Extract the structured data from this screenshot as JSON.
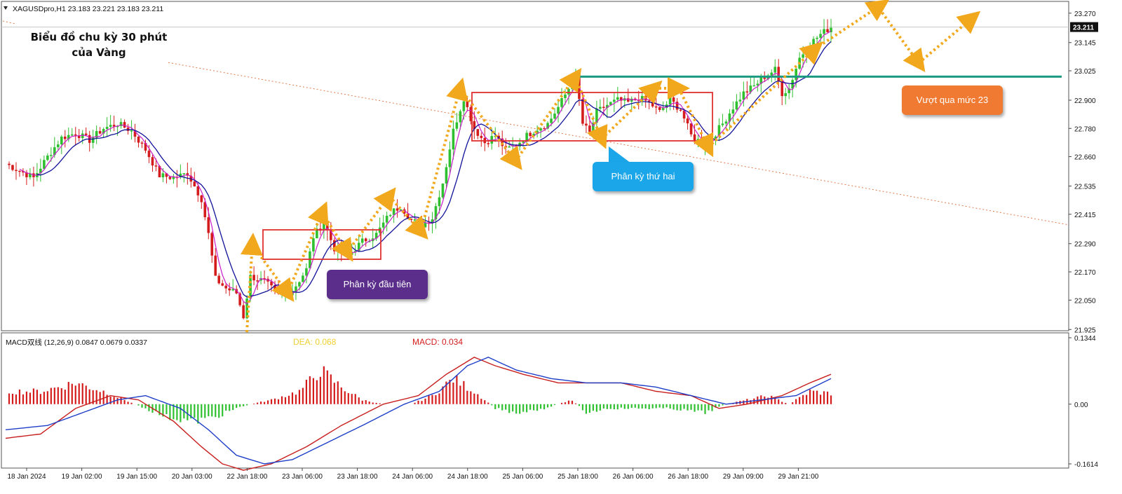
{
  "symbol_header": "XAGUSDpro,H1  23.183 23.221 23.183 23.211",
  "heading": {
    "line1": "Biểu đồ chu kỳ 30 phút",
    "line2": "của Vàng"
  },
  "callouts": {
    "first_divergence": "Phân kỳ đầu tiên",
    "second_divergence": "Phân kỳ thứ hai",
    "breakout": "Vượt qua mức 23"
  },
  "colors": {
    "bull": "#2fc02f",
    "bear": "#d41c1c",
    "ma_fast": "#c81ec8",
    "ma_slow": "#12129a",
    "resistance": "#1a9a80",
    "arrows": "#f2a81c",
    "box": "#e03030",
    "trendline": "#e07a4a",
    "first_callout": "#5b2e8c",
    "second_callout": "#1aa6e8",
    "breakout_callout": "#f07a32",
    "dea_label": "#f0d030",
    "macd_label": "#d41c1c"
  },
  "macd_panel": {
    "header": "MACD双线 (12,26,9) 0.0847 0.0679 0.0337",
    "dea_label": "DEA:  0.068",
    "macd_label": "MACD:  0.034"
  },
  "chart_data": {
    "type": "candlestick",
    "price_axis": {
      "ticks": [
        "23.270",
        "23.145",
        "23.025",
        "22.900",
        "22.780",
        "22.660",
        "22.535",
        "22.415",
        "22.290",
        "22.170",
        "22.050",
        "21.925"
      ],
      "current": "23.211",
      "range": [
        21.89,
        23.32
      ]
    },
    "macd_axis": {
      "ticks": [
        "0.1344",
        "0.00",
        "-0.1614"
      ],
      "range": [
        -0.1614,
        0.1344
      ]
    },
    "x_ticks": [
      "18 Jan 2024",
      "19 Jan 02:00",
      "19 Jan 15:00",
      "20 Jan 03:00",
      "22 Jan 18:00",
      "23 Jan 06:00",
      "23 Jan 18:00",
      "24 Jan 06:00",
      "24 Jan 18:00",
      "25 Jan 06:00",
      "25 Jan 18:00",
      "26 Jan 06:00",
      "26 Jan 18:00",
      "29 Jan 09:00",
      "29 Jan 21:00"
    ],
    "resistance_level": 23.0,
    "close_anchors": [
      [
        0,
        22.63
      ],
      [
        4,
        22.6
      ],
      [
        8,
        22.57
      ],
      [
        12,
        22.66
      ],
      [
        16,
        22.74
      ],
      [
        20,
        22.76
      ],
      [
        24,
        22.73
      ],
      [
        28,
        22.78
      ],
      [
        32,
        22.8
      ],
      [
        36,
        22.77
      ],
      [
        40,
        22.69
      ],
      [
        44,
        22.58
      ],
      [
        48,
        22.57
      ],
      [
        52,
        22.59
      ],
      [
        56,
        22.48
      ],
      [
        58,
        22.33
      ],
      [
        60,
        22.14
      ],
      [
        63,
        22.1
      ],
      [
        66,
        22.08
      ],
      [
        68,
        21.98
      ],
      [
        70,
        22.15
      ],
      [
        74,
        22.13
      ],
      [
        78,
        22.07
      ],
      [
        82,
        22.09
      ],
      [
        86,
        22.18
      ],
      [
        88,
        22.32
      ],
      [
        91,
        22.38
      ],
      [
        94,
        22.27
      ],
      [
        98,
        22.24
      ],
      [
        102,
        22.3
      ],
      [
        106,
        22.33
      ],
      [
        110,
        22.42
      ],
      [
        113,
        22.45
      ],
      [
        116,
        22.39
      ],
      [
        119,
        22.37
      ],
      [
        122,
        22.4
      ],
      [
        125,
        22.55
      ],
      [
        128,
        22.77
      ],
      [
        131,
        22.91
      ],
      [
        134,
        22.78
      ],
      [
        137,
        22.72
      ],
      [
        140,
        22.75
      ],
      [
        143,
        22.69
      ],
      [
        146,
        22.71
      ],
      [
        149,
        22.75
      ],
      [
        152,
        22.78
      ],
      [
        155,
        22.8
      ],
      [
        158,
        22.87
      ],
      [
        161,
        22.95
      ],
      [
        163,
        23.0
      ],
      [
        165,
        22.8
      ],
      [
        167,
        22.76
      ],
      [
        169,
        22.85
      ],
      [
        172,
        22.88
      ],
      [
        175,
        22.9
      ],
      [
        178,
        22.89
      ],
      [
        181,
        22.91
      ],
      [
        184,
        22.89
      ],
      [
        187,
        22.85
      ],
      [
        190,
        22.9
      ],
      [
        193,
        22.86
      ],
      [
        196,
        22.75
      ],
      [
        199,
        22.72
      ],
      [
        202,
        22.74
      ],
      [
        205,
        22.8
      ],
      [
        208,
        22.87
      ],
      [
        211,
        22.93
      ],
      [
        214,
        22.96
      ],
      [
        217,
        23.0
      ],
      [
        220,
        23.03
      ],
      [
        222,
        22.93
      ],
      [
        224,
        22.95
      ],
      [
        227,
        23.08
      ],
      [
        230,
        23.14
      ],
      [
        233,
        23.18
      ],
      [
        236,
        23.211
      ]
    ],
    "macd_line_anchors": [
      [
        0,
        -0.08
      ],
      [
        10,
        -0.07
      ],
      [
        20,
        -0.01
      ],
      [
        30,
        0.02
      ],
      [
        38,
        0.01
      ],
      [
        48,
        -0.04
      ],
      [
        56,
        -0.1
      ],
      [
        62,
        -0.14
      ],
      [
        68,
        -0.155
      ],
      [
        76,
        -0.14
      ],
      [
        86,
        -0.1
      ],
      [
        96,
        -0.05
      ],
      [
        108,
        0.0
      ],
      [
        118,
        0.02
      ],
      [
        126,
        0.07
      ],
      [
        134,
        0.11
      ],
      [
        140,
        0.09
      ],
      [
        148,
        0.07
      ],
      [
        158,
        0.05
      ],
      [
        166,
        0.05
      ],
      [
        176,
        0.05
      ],
      [
        186,
        0.03
      ],
      [
        196,
        0.02
      ],
      [
        204,
        -0.01
      ],
      [
        212,
        0.0
      ],
      [
        222,
        0.02
      ],
      [
        230,
        0.05
      ],
      [
        236,
        0.07
      ]
    ],
    "signal_line_anchors": [
      [
        0,
        -0.06
      ],
      [
        12,
        -0.05
      ],
      [
        22,
        -0.02
      ],
      [
        32,
        0.01
      ],
      [
        40,
        0.02
      ],
      [
        50,
        -0.01
      ],
      [
        58,
        -0.06
      ],
      [
        66,
        -0.12
      ],
      [
        74,
        -0.14
      ],
      [
        82,
        -0.13
      ],
      [
        92,
        -0.09
      ],
      [
        102,
        -0.05
      ],
      [
        114,
        0.0
      ],
      [
        124,
        0.03
      ],
      [
        132,
        0.09
      ],
      [
        138,
        0.11
      ],
      [
        146,
        0.08
      ],
      [
        156,
        0.06
      ],
      [
        166,
        0.05
      ],
      [
        176,
        0.05
      ],
      [
        186,
        0.04
      ],
      [
        196,
        0.02
      ],
      [
        206,
        0.0
      ],
      [
        216,
        0.01
      ],
      [
        226,
        0.02
      ],
      [
        236,
        0.06
      ]
    ],
    "histogram_anchors": [
      [
        0,
        0.03
      ],
      [
        10,
        0.03
      ],
      [
        20,
        0.05
      ],
      [
        28,
        0.03
      ],
      [
        34,
        0.01
      ],
      [
        40,
        -0.01
      ],
      [
        46,
        -0.03
      ],
      [
        54,
        -0.04
      ],
      [
        60,
        -0.03
      ],
      [
        66,
        -0.01
      ],
      [
        70,
        0.0
      ],
      [
        76,
        0.01
      ],
      [
        84,
        0.03
      ],
      [
        90,
        0.08
      ],
      [
        96,
        0.04
      ],
      [
        102,
        0.01
      ],
      [
        108,
        0.0
      ],
      [
        116,
        0.0
      ],
      [
        122,
        0.02
      ],
      [
        128,
        0.06
      ],
      [
        134,
        0.03
      ],
      [
        140,
        -0.01
      ],
      [
        146,
        -0.02
      ],
      [
        154,
        -0.01
      ],
      [
        162,
        0.01
      ],
      [
        166,
        -0.02
      ],
      [
        172,
        -0.01
      ],
      [
        180,
        -0.01
      ],
      [
        190,
        -0.01
      ],
      [
        200,
        -0.02
      ],
      [
        206,
        0.0
      ],
      [
        212,
        0.01
      ],
      [
        218,
        0.02
      ],
      [
        224,
        0.0
      ],
      [
        230,
        0.03
      ],
      [
        236,
        0.025
      ]
    ]
  }
}
